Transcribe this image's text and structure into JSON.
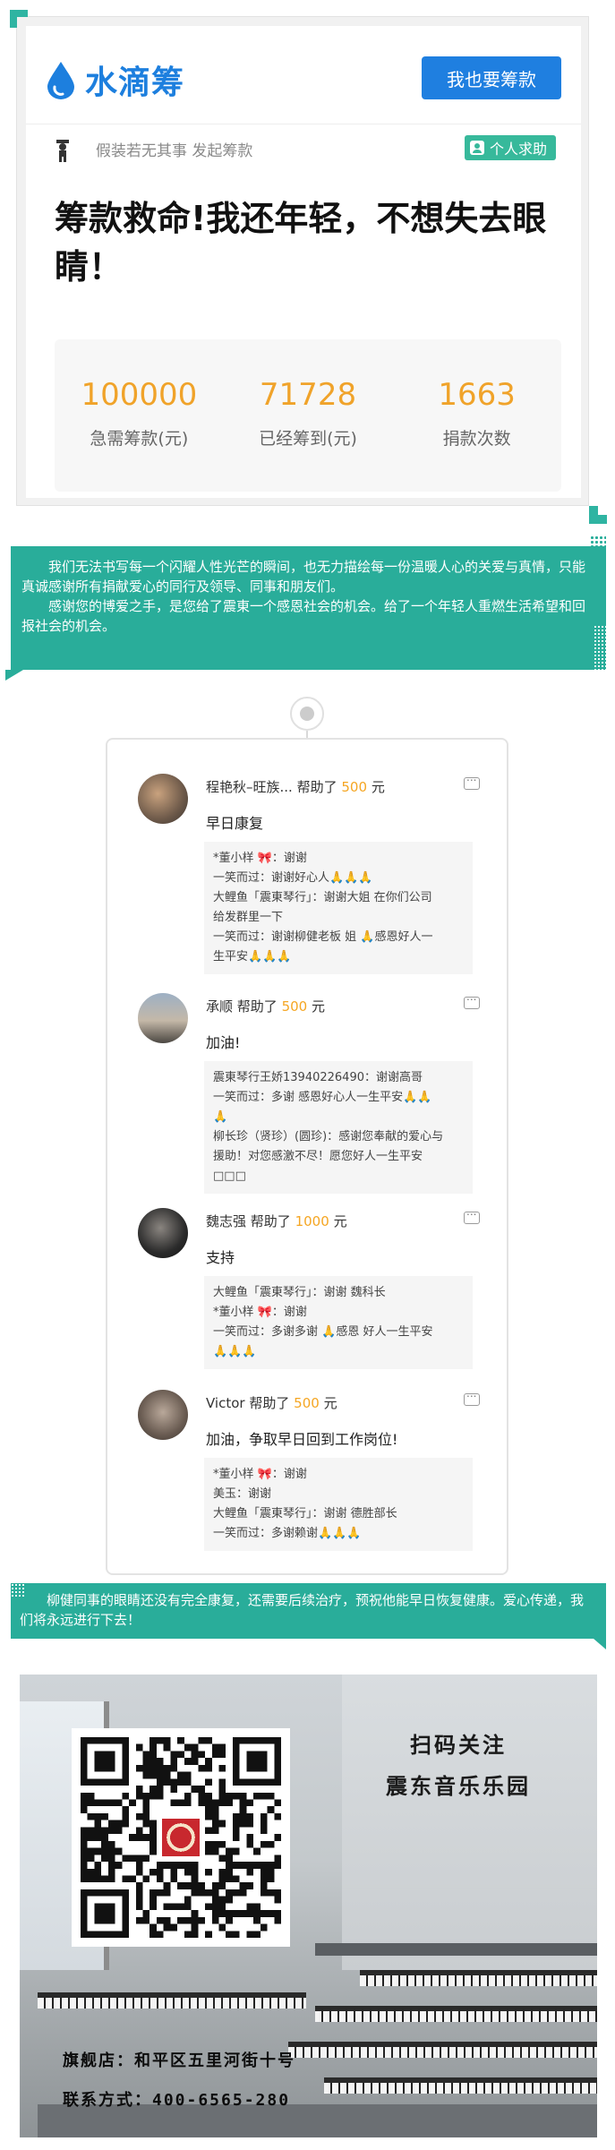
{
  "screenshot": {
    "app_name": "水滴筹",
    "cta_button": "我也要筹款",
    "subtitle": "假装若无其事 发起筹款",
    "help_badge": "个人求助",
    "title": "筹款救命!我还年轻，不想失去眼睛！",
    "stats": [
      {
        "value": "100000",
        "label": "急需筹款(元)"
      },
      {
        "value": "71728",
        "label": "已经筹到(元)"
      },
      {
        "value": "1663",
        "label": "捐款次数"
      }
    ],
    "colors": {
      "brand_blue": "#1f7fe0",
      "accent_orange": "#f0a32a",
      "help_green": "#37b99b"
    }
  },
  "banner1": {
    "para1": "我们无法书写每一个闪耀人性光芒的瞬间，也无力描绘每一份温暖人心的关爱与真情，只能真诚感谢所有捐献爱心的同行及领导、同事和朋友们。",
    "para2": "感谢您的博爱之手，是您给了震東一个感恩社会的机会。给了一个年轻人重燃生活希望和回报社会的机会。"
  },
  "comments": [
    {
      "name": "程艳秋–旺族...",
      "helped": "帮助了",
      "amount": "500",
      "unit": "元",
      "text": "早日康复",
      "replies": [
        "*董小样 🎀：谢谢",
        "一笑而过：谢谢好心人🙏🙏🙏",
        "大鲤鱼「震東琴行」：谢谢大姐 在你们公司",
        "给发群里一下",
        "一笑而过：谢谢柳健老板 姐 🙏感恩好人一",
        "生平安🙏🙏🙏"
      ]
    },
    {
      "name": "承顺",
      "helped": "帮助了",
      "amount": "500",
      "unit": "元",
      "text": "加油!",
      "replies": [
        "震東琴行王娇13940226490：谢谢高哥",
        "一笑而过：多谢 感恩好心人一生平安🙏🙏",
        "🙏",
        "柳长珍（贤珍）(圆珍)：感谢您奉献的爱心与",
        "援助！对您感激不尽！愿您好人一生平安",
        "□□□"
      ]
    },
    {
      "name": "魏志强",
      "helped": "帮助了",
      "amount": "1000",
      "unit": "元",
      "text": "支持",
      "replies": [
        "大鲤鱼「震東琴行」：谢谢 魏科长",
        "*董小样 🎀：谢谢",
        "一笑而过：多谢多谢 🙏感恩 好人一生平安",
        "🙏🙏🙏"
      ]
    },
    {
      "name": "Victor",
      "helped": "帮助了",
      "amount": "500",
      "unit": "元",
      "text": "加油，争取早日回到工作岗位!",
      "replies": [
        "*董小样 🎀：谢谢",
        "美玉：谢谢",
        "大鲤鱼「震東琴行」：谢谢 德胜部长",
        "一笑而过：多谢赖谢🙏🙏🙏"
      ]
    }
  ],
  "banner2": {
    "text": "柳健同事的眼睛还没有完全康复，还需要后续治疗，预祝他能早日恢复健康。爱心传递，我们将永远进行下去！"
  },
  "poster": {
    "scan_line1": "扫码关注",
    "scan_line2": "震东音乐乐园",
    "store_line": "旗舰店：和平区五里河街十号",
    "contact_line": "联系方式：400-6565-280"
  }
}
